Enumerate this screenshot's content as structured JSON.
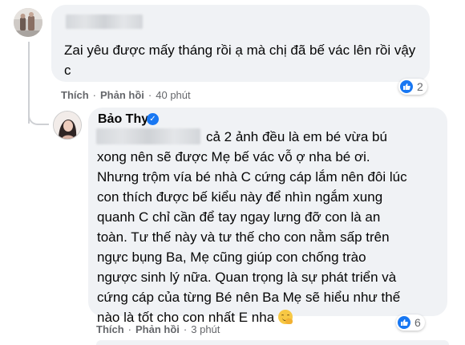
{
  "comments": [
    {
      "text": "Zai yêu được mấy tháng rồi ạ mà chị đã bế vác lên rồi vậy c",
      "reaction_count": "2",
      "actions": {
        "like": "Thích",
        "reply": "Phản hồi",
        "time": "40 phút",
        "sep": "·"
      }
    },
    {
      "author": "Bảo Thy",
      "lines": [
        "cả 2 ảnh đều là em bé vừa bú",
        "xong nên sẽ được Mẹ bế vác vỗ ợ nha bé ơi.",
        "Nhưng trộm vía bé nhà C cứng cáp lắm nên đôi lúc",
        "con thích được bế kiểu này để nhìn ngắm xung",
        "quanh C chỉ cần để tay ngay lưng đỡ con là an",
        "toàn. Tư thế này và tư thế cho con nằm sấp trên",
        "ngực bụng Ba, Mẹ cũng giúp con chống trào",
        "ngược sinh lý nữa. Quan trọng là sự phát triển và",
        "cứng cáp của từng Bé nên Ba Mẹ sẽ hiểu như thế",
        "nào là tốt cho con nhất E nha"
      ],
      "reaction_count": "6",
      "actions": {
        "like": "Thích",
        "reply": "Phản hồi",
        "time": "3 phút",
        "sep": "·"
      }
    }
  ],
  "colors": {
    "like_blue": "#1877f2",
    "bubble_bg": "#f0f2f5",
    "meta_gray": "#65676b"
  }
}
